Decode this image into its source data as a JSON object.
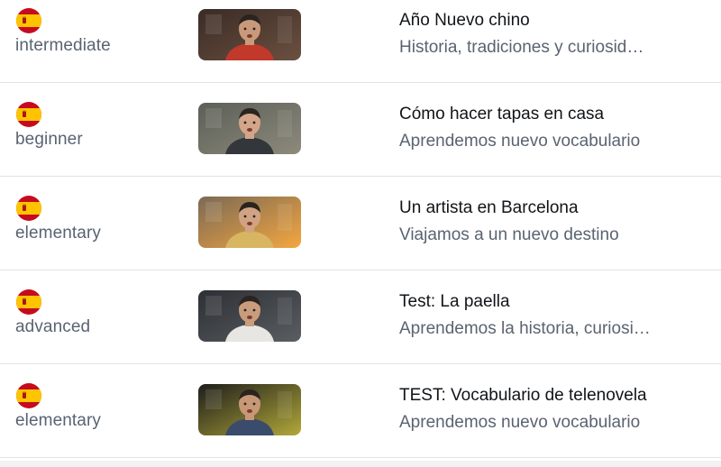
{
  "lessons": [
    {
      "flag_icon": "spain-flag-icon",
      "level": "intermediate",
      "title": "Año Nuevo chino",
      "description": "Historia, tradiciones y curiosidades",
      "thumb": {
        "bg1": "#3a2b25",
        "bg2": "#6b5040",
        "skin": "#c99a7a",
        "shirt": "#c0392b"
      }
    },
    {
      "flag_icon": "spain-flag-icon",
      "level": "beginner",
      "title": "Cómo hacer tapas en casa",
      "description": "Aprendemos nuevo vocabulario",
      "thumb": {
        "bg1": "#5b5f57",
        "bg2": "#8e8a7c",
        "skin": "#d4a588",
        "shirt": "#33363a"
      }
    },
    {
      "flag_icon": "spain-flag-icon",
      "level": "elementary",
      "title": "Un artista en Barcelona",
      "description": "Viajamos a un nuevo destino",
      "thumb": {
        "bg1": "#7b6a55",
        "bg2": "#f4a640",
        "skin": "#d1a383",
        "shirt": "#d8b560"
      }
    },
    {
      "flag_icon": "spain-flag-icon",
      "level": "advanced",
      "title": "Test: La paella",
      "description": "Aprendemos la historia, curiosidades",
      "thumb": {
        "bg1": "#2c2f33",
        "bg2": "#5a5e63",
        "skin": "#c99c7c",
        "shirt": "#e8e6e2"
      }
    },
    {
      "flag_icon": "spain-flag-icon",
      "level": "elementary",
      "title": "TEST: Vocabulario de telenovela",
      "description": "Aprendemos nuevo vocabulario",
      "thumb": {
        "bg1": "#1d1d1b",
        "bg2": "#b2a83a",
        "skin": "#c89775",
        "shirt": "#3a4b6b"
      }
    }
  ]
}
